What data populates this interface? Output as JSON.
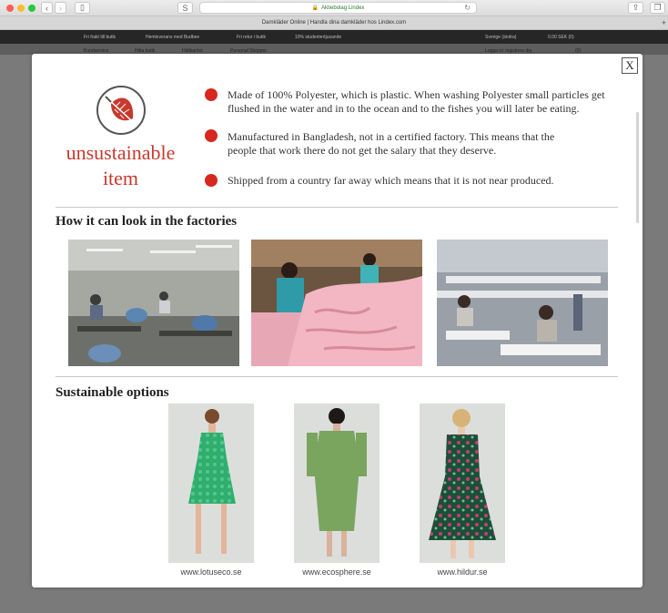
{
  "browser": {
    "address": "Aktiebolag Lindex",
    "tab_title": "Damkläder Online | Handla dina damkläder hos Lindex.com",
    "sidebar_glyph": "S"
  },
  "site": {
    "nav": [
      "Fri frakt till butik",
      "Hemleverans med Budbee",
      "Fri retur i butik",
      "10% studentertjusande",
      "Sverige (ändra)",
      "0.00 SEK (0)"
    ],
    "sub": [
      "Kundservice",
      "Hitta butik",
      "Hållbarhet",
      "Personal Shopper",
      "Logga in/ registrera dig",
      "(0)"
    ]
  },
  "modal": {
    "close_label": "X",
    "status_label": "unsustainable item",
    "status_line1": "unsustainable",
    "status_line2": "item",
    "accent_color": "#d6281f",
    "reasons": [
      {
        "line1": "Made of 100% Polyester, which is plastic. When washing Polyester small particles get",
        "line2": "flushed in the water and in to the ocean and to the fishes you will later be eating."
      },
      {
        "line1": "Manufactured in Bangladesh, not in a certified factory. This means that the",
        "line2": "people that work there do not get the salary that they deserve."
      },
      {
        "line1": "Shipped from a country far away which means that it is not near produced.",
        "line2": ""
      }
    ],
    "factories_title": "How it can look in the factories",
    "options_title": "Sustainable options",
    "options": [
      {
        "url": "www.lotuseco.se"
      },
      {
        "url": "www.ecosphere.se"
      },
      {
        "url": "www.hildur.se"
      }
    ]
  }
}
